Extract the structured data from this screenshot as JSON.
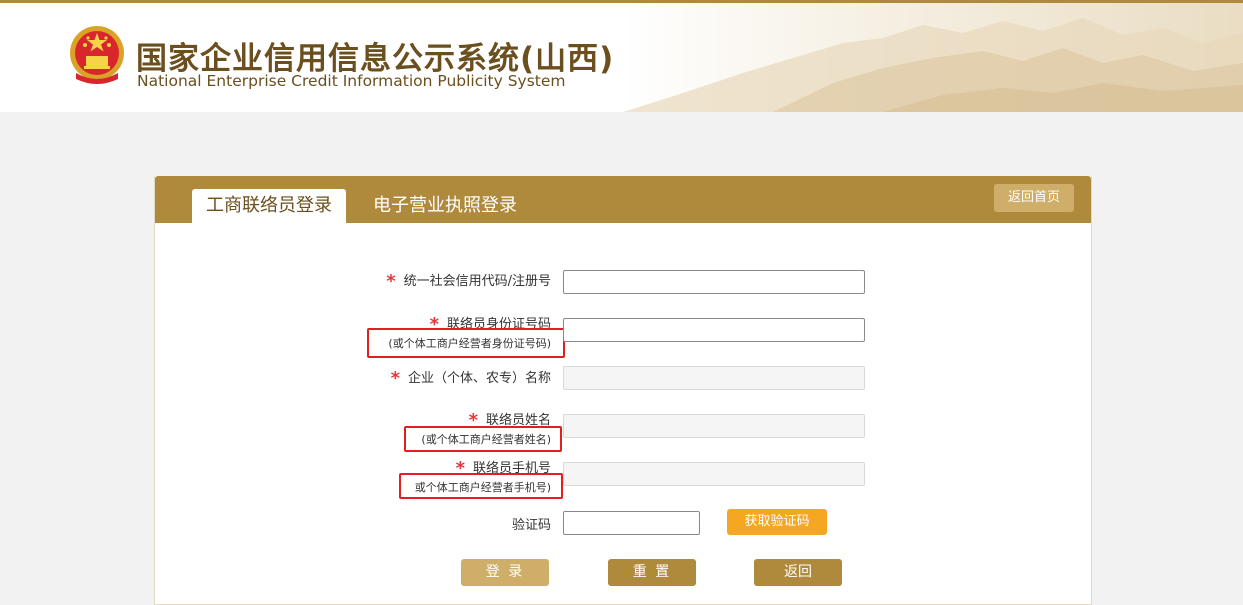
{
  "header": {
    "title_cn": "国家企业信用信息公示系统(山西)",
    "title_en": "National Enterprise Credit Information Publicity System"
  },
  "tabs": [
    {
      "label": "工商联络员登录",
      "active": true
    },
    {
      "label": "电子营业执照登录",
      "active": false
    }
  ],
  "home_button": "返回首页",
  "form": {
    "credit_code_label": "统一社会信用代码/注册号",
    "id_label": "联络员身份证号码",
    "id_sub": "(或个体工商户经营者身份证号码)",
    "company_label": "企业（个体、农专）名称",
    "name_label": "联络员姓名",
    "name_sub": "(或个体工商户经营者姓名)",
    "phone_label": "联络员手机号",
    "phone_sub": "或个体工商户经营者手机号)",
    "captcha_label": "验证码",
    "get_code_button": "获取验证码",
    "required_mark": "*"
  },
  "actions": {
    "login": "登 录",
    "reset": "重 置",
    "back": "返回"
  },
  "colors": {
    "brand": "#b08a3c",
    "accent": "#f5a623",
    "highlight": "#e02020"
  }
}
